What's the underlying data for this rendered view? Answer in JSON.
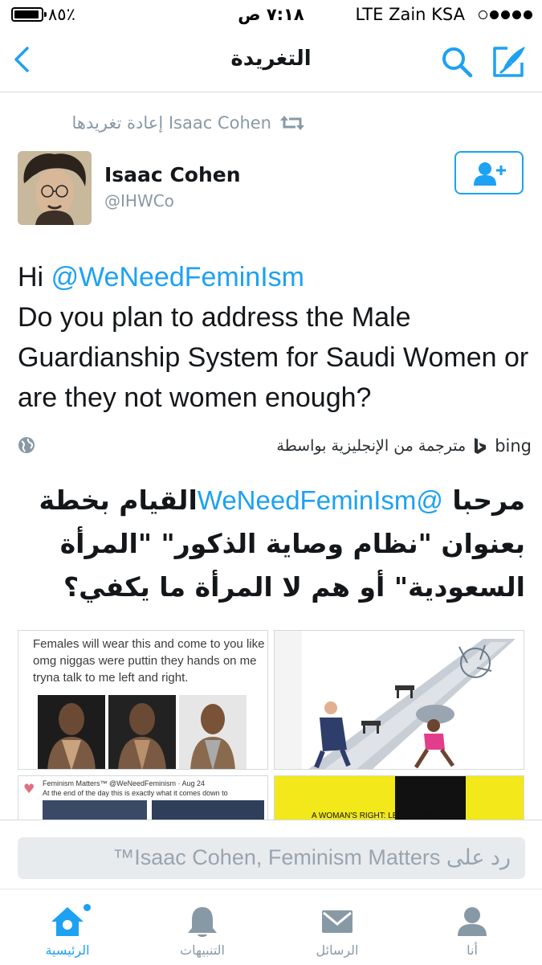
{
  "status_bar": {
    "battery_percent": "٪٨٥",
    "time": "٧:١٨ ص",
    "carrier": "LTE  Zain KSA"
  },
  "nav": {
    "title": "التغريدة",
    "back_icon": "chevron-left-icon",
    "search_icon": "search-icon",
    "compose_icon": "compose-icon"
  },
  "retweet": {
    "text": "Isaac Cohen إعادة تغريدها",
    "icon": "retweet-icon"
  },
  "author": {
    "name": "Isaac Cohen",
    "handle": "@IHWCo",
    "follow_icon": "add-user-icon"
  },
  "tweet": {
    "greeting": "Hi ",
    "mention": "@WeNeedFeminIsm",
    "body": "Do you plan to address the Male Guardianship System for Saudi Women or are they not women enough?"
  },
  "translation": {
    "label": "مترجمة من الإنجليزية بواسطة",
    "provider": "bing",
    "globe_icon": "globe-icon"
  },
  "translated": {
    "start": "مرحبا ",
    "mention": "@WeNeedFeminIsm",
    "rest": "القيام بخطة بعنوان \"نظام وصاية الذكور\" \"المرأة السعودية\" أو هم لا المرأة ما يكفي؟"
  },
  "media": {
    "image1_caption": "Females will wear this and come to you like omg niggas were puttin they hands on me tryna talk to me left and right.",
    "image3_header": "Feminism Matters™ @WeNeedFeminism · Aug 24",
    "image3_body": "At the end of the day this is exactly what it comes down to",
    "image4_text": "A WOMAN'S RIGHT: LEFT BEHIND"
  },
  "reply": {
    "placeholder": "رد على Isaac Cohen, Feminism Matters™"
  },
  "tabs": [
    {
      "label": "الرئيسية",
      "icon": "home-icon",
      "active": true
    },
    {
      "label": "التنبيهات",
      "icon": "bell-icon",
      "active": false
    },
    {
      "label": "الرسائل",
      "icon": "mail-icon",
      "active": false
    },
    {
      "label": "أنا",
      "icon": "profile-icon",
      "active": false
    }
  ],
  "colors": {
    "accent": "#1da1f2",
    "muted": "#8899a6",
    "text": "#14171a"
  }
}
